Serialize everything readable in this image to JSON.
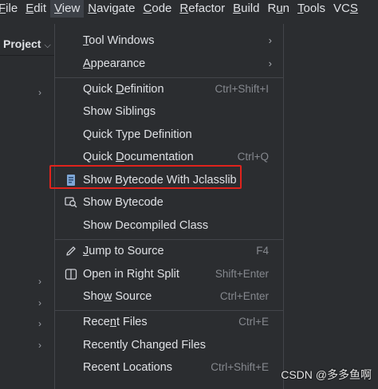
{
  "menubar": {
    "items": [
      {
        "pre": "",
        "ul": "F",
        "post": "ile"
      },
      {
        "pre": "",
        "ul": "E",
        "post": "dit"
      },
      {
        "pre": "",
        "ul": "V",
        "post": "iew"
      },
      {
        "pre": "",
        "ul": "N",
        "post": "avigate"
      },
      {
        "pre": "",
        "ul": "C",
        "post": "ode"
      },
      {
        "pre": "",
        "ul": "R",
        "post": "efactor"
      },
      {
        "pre": "",
        "ul": "B",
        "post": "uild"
      },
      {
        "pre": "R",
        "ul": "u",
        "post": "n"
      },
      {
        "pre": "",
        "ul": "T",
        "post": "ools"
      },
      {
        "pre": "VC",
        "ul": "S",
        "post": ""
      }
    ]
  },
  "project": {
    "title": "Project",
    "chevron": "⌵"
  },
  "tree_arrow": "›",
  "menu": {
    "tool_windows": {
      "pre": "",
      "ul": "T",
      "post": "ool Windows",
      "arrow": "›"
    },
    "appearance": {
      "pre": "",
      "ul": "A",
      "post": "ppearance",
      "arrow": "›"
    },
    "quick_definition": {
      "pre": "Quick ",
      "ul": "D",
      "post": "efinition",
      "shortcut": "Ctrl+Shift+I"
    },
    "show_siblings": {
      "label": "Show Siblings"
    },
    "quick_type_definition": {
      "label": "Quick Type Definition"
    },
    "quick_documentation": {
      "pre": "Quick ",
      "ul": "D",
      "post": "ocumentation",
      "shortcut": "Ctrl+Q"
    },
    "show_bytecode_jclasslib": {
      "label": "Show Bytecode With Jclasslib"
    },
    "show_bytecode": {
      "label": "Show Bytecode"
    },
    "show_decompiled": {
      "label": "Show Decompiled Class"
    },
    "jump_to_source": {
      "pre": "",
      "ul": "J",
      "post": "ump to Source",
      "shortcut": "F4"
    },
    "open_right_split": {
      "label": "Open in Right Split",
      "shortcut": "Shift+Enter"
    },
    "show_source": {
      "pre": "Sho",
      "ul": "w",
      "post": " Source",
      "shortcut": "Ctrl+Enter"
    },
    "recent_files": {
      "pre": "Rece",
      "ul": "n",
      "post": "t Files",
      "shortcut": "Ctrl+E"
    },
    "recently_changed": {
      "label": "Recently Changed Files"
    },
    "recent_locations": {
      "label": "Recent Locations",
      "shortcut": "Ctrl+Shift+E"
    }
  },
  "watermark": "CSDN @多多鱼啊",
  "colors": {
    "background": "#2b2d30",
    "highlight_border": "#e0231c",
    "text": "#dfe1e5",
    "shortcut": "#85888e"
  }
}
